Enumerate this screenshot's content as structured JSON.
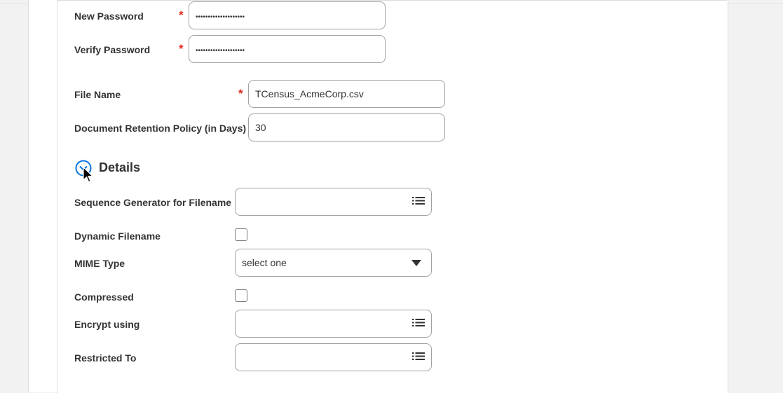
{
  "form": {
    "new_password": {
      "label": "New Password",
      "required": "*",
      "value": "••••••••••••••••••••"
    },
    "verify_password": {
      "label": "Verify Password",
      "required": "*",
      "value": "••••••••••••••••••••"
    },
    "file_name": {
      "label": "File Name",
      "required": "*",
      "value": "TCensus_AcmeCorp.csv"
    },
    "retention": {
      "label": "Document Retention Policy (in Days)",
      "value": "30"
    }
  },
  "details": {
    "title": "Details",
    "toggle_icon": "collapse-toggle-icon",
    "sequence_generator": {
      "label": "Sequence Generator for Filename",
      "value": "",
      "icon": "list-icon"
    },
    "dynamic_filename": {
      "label": "Dynamic Filename",
      "checked": false
    },
    "mime_type": {
      "label": "MIME Type",
      "value": "select one",
      "icon": "dropdown-arrow-icon"
    },
    "compressed": {
      "label": "Compressed",
      "checked": false
    },
    "encrypt_using": {
      "label": "Encrypt using",
      "value": "",
      "icon": "list-icon"
    },
    "restricted_to": {
      "label": "Restricted To",
      "value": "",
      "icon": "list-icon"
    }
  },
  "colors": {
    "required": "#de2e21",
    "accent": "#0875e1",
    "border": "#a0a2a6"
  }
}
